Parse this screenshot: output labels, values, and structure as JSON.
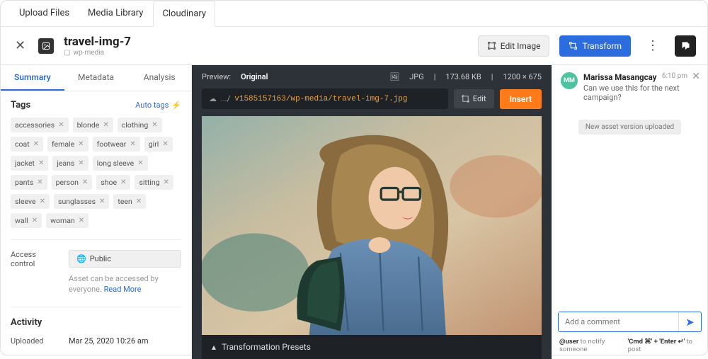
{
  "top_tabs": [
    "Upload Files",
    "Media Library",
    "Cloudinary"
  ],
  "top_tab_active": 2,
  "file": {
    "title": "travel-img-7",
    "folder": "wp-media"
  },
  "header": {
    "edit_image": "Edit Image",
    "transform": "Transform"
  },
  "inner_tabs": [
    "Summary",
    "Metadata",
    "Analysis"
  ],
  "inner_tab_active": 0,
  "tags": {
    "heading": "Tags",
    "auto_link": "Auto tags",
    "items": [
      "accessories",
      "blonde",
      "clothing",
      "coat",
      "female",
      "footwear",
      "girl",
      "jacket",
      "jeans",
      "long sleeve",
      "pants",
      "person",
      "shoe",
      "sitting",
      "sleeve",
      "sunglasses",
      "teen",
      "wall",
      "woman"
    ]
  },
  "access": {
    "label": "Access control",
    "button": "Public",
    "note": "Asset can be accessed by everyone.",
    "read_more": "Read More"
  },
  "activity": {
    "heading": "Activity",
    "uploaded_label": "Uploaded",
    "uploaded_value": "Mar 25, 2020 10:26 am"
  },
  "preview": {
    "label": "Preview:",
    "mode": "Original",
    "format": "JPG",
    "size": "173.68 KB",
    "dimensions": "1200 × 675",
    "url_prefix": ".../",
    "url_path": "v1585157163/wp-media/travel-img-7.jpg",
    "edit": "Edit",
    "insert": "Insert",
    "presets": "Transformation Presets"
  },
  "comment": {
    "avatar": "MM",
    "name": "Marissa Masangcay",
    "time": "6:10 pm",
    "body": "Can we use this for the next campaign?",
    "event": "New asset version uploaded",
    "input_placeholder": "Add a comment",
    "hint_user_prefix": "@user",
    "hint_user_rest": " to notify someone",
    "hint_post_prefix": "'Cmd ⌘' + 'Enter ↵'",
    "hint_post_rest": " to post"
  }
}
